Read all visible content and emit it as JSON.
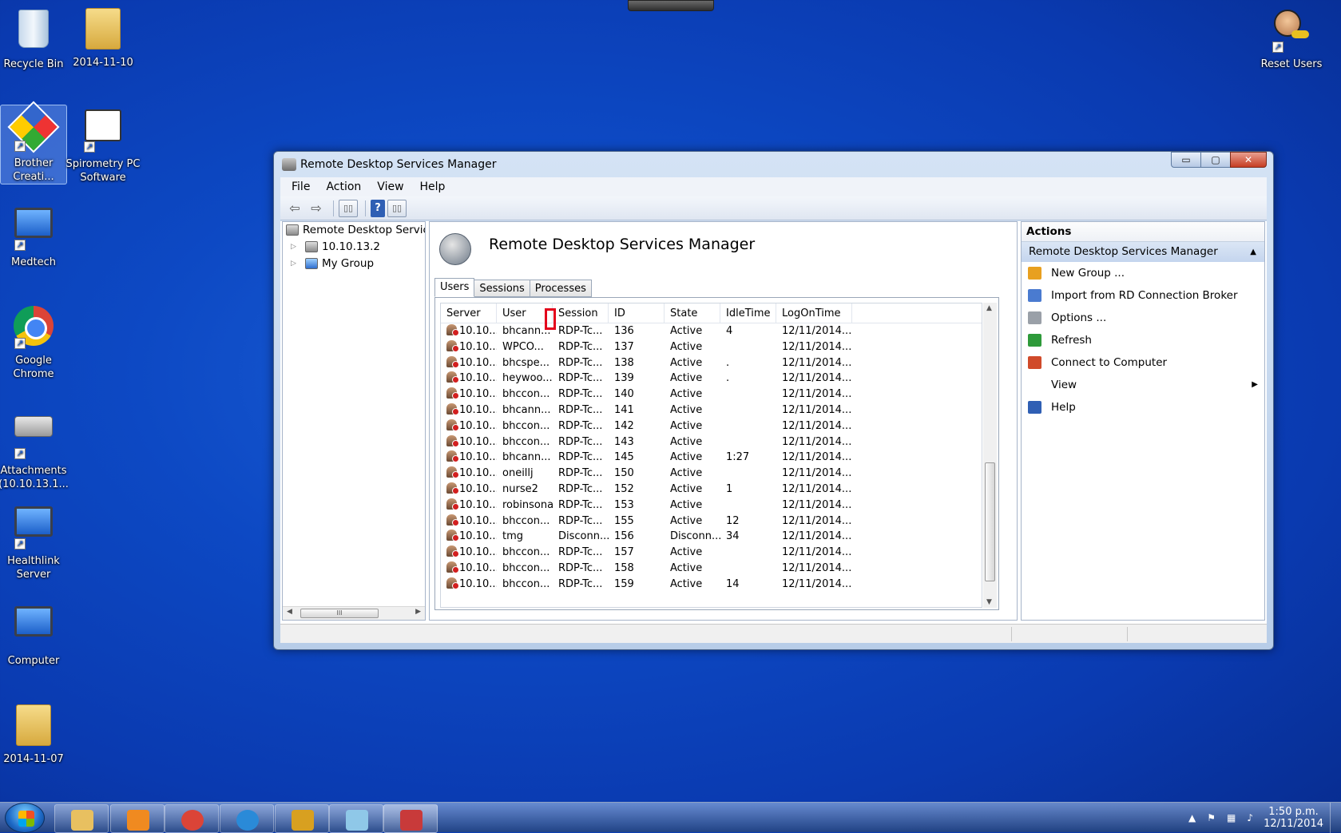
{
  "desktop": {
    "icons": [
      {
        "label": "Recycle Bin",
        "icon": "recycle-bin-icon"
      },
      {
        "label": "2014-11-10",
        "icon": "folder-icon"
      },
      {
        "label": "Brother Creati...",
        "icon": "brother-app-icon"
      },
      {
        "label": "Spirometry PC Software",
        "icon": "spirometry-icon"
      },
      {
        "label": "Medtech",
        "icon": "remote-desktop-icon"
      },
      {
        "label": "Google Chrome",
        "icon": "chrome-icon"
      },
      {
        "label": "Attachments (10.10.13.1...",
        "icon": "network-drive-icon"
      },
      {
        "label": "Healthlink Server",
        "icon": "remote-desktop-icon"
      },
      {
        "label": "Computer",
        "icon": "computer-icon"
      },
      {
        "label": "2014-11-07",
        "icon": "folder-icon"
      },
      {
        "label": "Reset Users",
        "icon": "reset-users-icon"
      }
    ]
  },
  "window": {
    "title": "Remote Desktop Services Manager",
    "controls": {
      "minimize": "▭",
      "maximize": "▢",
      "close": "✕"
    },
    "menu": [
      "File",
      "Action",
      "View",
      "Help"
    ],
    "toolbar": {
      "back": "⇦",
      "forward": "⇨",
      "help": "?"
    }
  },
  "tree": {
    "root": "Remote Desktop Services Manager",
    "children": [
      {
        "label": "10.10.13.2",
        "expander": "▷"
      },
      {
        "label": "My Group",
        "expander": "▷"
      }
    ]
  },
  "center": {
    "title": "Remote Desktop Services Manager",
    "tabs": [
      "Users",
      "Sessions",
      "Processes"
    ],
    "active_tab": "Users",
    "columns": [
      "Server",
      "User",
      "Session",
      "ID",
      "State",
      "IdleTime",
      "LogOnTime"
    ],
    "rows": [
      [
        "10.10...",
        "bhcann...",
        "RDP-Tc...",
        "136",
        "Active",
        "4",
        "12/11/2014..."
      ],
      [
        "10.10...",
        "WPCO...",
        "RDP-Tc...",
        "137",
        "Active",
        "",
        "12/11/2014..."
      ],
      [
        "10.10...",
        "bhcspe...",
        "RDP-Tc...",
        "138",
        "Active",
        ".",
        "12/11/2014..."
      ],
      [
        "10.10...",
        "heywoo...",
        "RDP-Tc...",
        "139",
        "Active",
        ".",
        "12/11/2014..."
      ],
      [
        "10.10...",
        "bhccon...",
        "RDP-Tc...",
        "140",
        "Active",
        "",
        "12/11/2014..."
      ],
      [
        "10.10...",
        "bhcann...",
        "RDP-Tc...",
        "141",
        "Active",
        "",
        "12/11/2014..."
      ],
      [
        "10.10...",
        "bhccon...",
        "RDP-Tc...",
        "142",
        "Active",
        "",
        "12/11/2014..."
      ],
      [
        "10.10...",
        "bhccon...",
        "RDP-Tc...",
        "143",
        "Active",
        "",
        "12/11/2014..."
      ],
      [
        "10.10...",
        "bhcann...",
        "RDP-Tc...",
        "145",
        "Active",
        "1:27",
        "12/11/2014..."
      ],
      [
        "10.10...",
        "oneillj",
        "RDP-Tc...",
        "150",
        "Active",
        "",
        "12/11/2014..."
      ],
      [
        "10.10...",
        "nurse2",
        "RDP-Tc...",
        "152",
        "Active",
        "1",
        "12/11/2014..."
      ],
      [
        "10.10...",
        "robinsona",
        "RDP-Tc...",
        "153",
        "Active",
        "",
        "12/11/2014..."
      ],
      [
        "10.10...",
        "bhccon...",
        "RDP-Tc...",
        "155",
        "Active",
        "12",
        "12/11/2014..."
      ],
      [
        "10.10...",
        "tmg",
        "Disconn...",
        "156",
        "Disconn...",
        "34",
        "12/11/2014..."
      ],
      [
        "10.10...",
        "bhccon...",
        "RDP-Tc...",
        "157",
        "Active",
        "",
        "12/11/2014..."
      ],
      [
        "10.10...",
        "bhccon...",
        "RDP-Tc...",
        "158",
        "Active",
        "",
        "12/11/2014..."
      ],
      [
        "10.10...",
        "bhccon...",
        "RDP-Tc...",
        "159",
        "Active",
        "14",
        "12/11/2014..."
      ]
    ]
  },
  "actions": {
    "header": "Actions",
    "section": "Remote Desktop Services Manager",
    "items": [
      {
        "label": "New Group ...",
        "icon": "new-group-icon",
        "color": "#e8a020"
      },
      {
        "label": "Import from RD Connection Broker",
        "icon": "import-icon",
        "color": "#4a7bd0"
      },
      {
        "label": "Options ...",
        "icon": "options-icon",
        "color": "#9aa0a8"
      },
      {
        "label": "Refresh",
        "icon": "refresh-icon",
        "color": "#2e9a3a"
      },
      {
        "label": "Connect to Computer",
        "icon": "connect-icon",
        "color": "#d04a2a"
      },
      {
        "label": "View",
        "icon": "",
        "color": ""
      },
      {
        "label": "Help",
        "icon": "help-icon",
        "color": "#2f5fb4"
      }
    ]
  },
  "taskbar": {
    "apps": [
      {
        "name": "explorer",
        "icon": "folder-icon",
        "color": "#e8c060"
      },
      {
        "name": "media-player",
        "icon": "media-player-icon",
        "color": "#f08a20"
      },
      {
        "name": "chrome",
        "icon": "chrome-icon",
        "color": "#db4437"
      },
      {
        "name": "internet-explorer",
        "icon": "ie-icon",
        "color": "#2a8ad8"
      },
      {
        "name": "settings",
        "icon": "gear-icon",
        "color": "#d8a020"
      },
      {
        "name": "notepad",
        "icon": "notepad-icon",
        "color": "#8fc8e8"
      },
      {
        "name": "toolbox",
        "icon": "toolbox-icon",
        "color": "#c83a3a"
      }
    ],
    "clock_time": "1:50 p.m.",
    "clock_date": "12/11/2014"
  }
}
